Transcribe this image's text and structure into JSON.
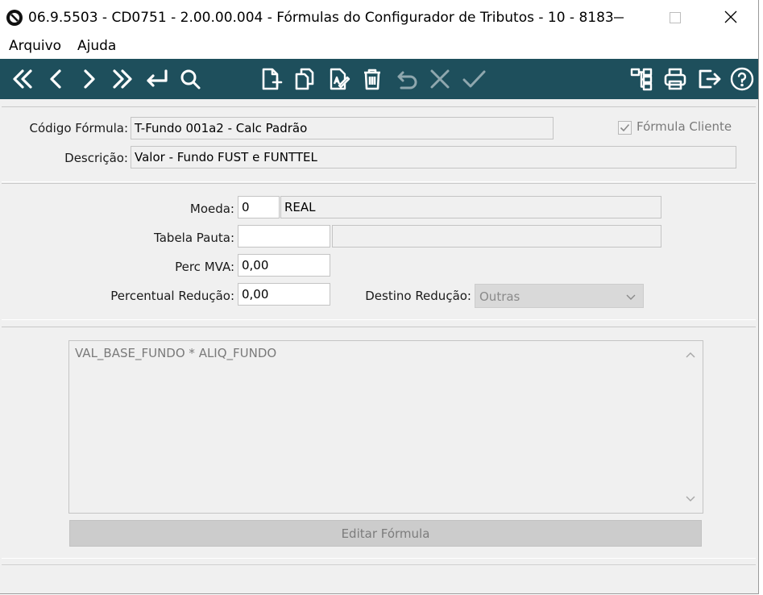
{
  "window": {
    "title": "06.9.5503 - CD0751 - 2.00.00.004 - Fórmulas do Configurador de Tributos - 10 - 8183"
  },
  "menu": {
    "items": [
      {
        "label": "Arquivo"
      },
      {
        "label": "Ajuda"
      }
    ]
  },
  "toolbar": {
    "colors": {
      "background": "#1e4f5c",
      "icon": "#ffffff"
    },
    "buttons": [
      {
        "icon": "first-record-icon",
        "enabled": true
      },
      {
        "icon": "previous-record-icon",
        "enabled": true
      },
      {
        "icon": "next-record-icon",
        "enabled": true
      },
      {
        "icon": "last-record-icon",
        "enabled": true
      },
      {
        "icon": "goto-record-icon",
        "enabled": true
      },
      {
        "icon": "search-icon",
        "enabled": true
      },
      {
        "icon": "new-record-icon",
        "enabled": true
      },
      {
        "icon": "copy-record-icon",
        "enabled": true
      },
      {
        "icon": "edit-record-icon",
        "enabled": true
      },
      {
        "icon": "delete-icon",
        "enabled": true
      },
      {
        "icon": "undo-icon",
        "enabled": false
      },
      {
        "icon": "cancel-icon",
        "enabled": false
      },
      {
        "icon": "confirm-icon",
        "enabled": false
      },
      {
        "icon": "tree-icon",
        "enabled": true
      },
      {
        "icon": "print-icon",
        "enabled": true
      },
      {
        "icon": "exit-icon",
        "enabled": true
      },
      {
        "icon": "help-icon",
        "enabled": true
      }
    ]
  },
  "header": {
    "codigo_label": "Código Fórmula:",
    "codigo_value": "T-Fundo 001a2 - Calc Padrão",
    "formula_cliente_label": "Fórmula Cliente",
    "formula_cliente_checked": true,
    "descricao_label": "Descrição:",
    "descricao_value": "Valor - Fundo FUST e FUNTTEL"
  },
  "params": {
    "moeda_label": "Moeda:",
    "moeda_code": "0",
    "moeda_name": "REAL",
    "tabela_pauta_label": "Tabela Pauta:",
    "tabela_pauta_code": "",
    "tabela_pauta_name": "",
    "perc_mva_label": "Perc MVA:",
    "perc_mva_value": "0,00",
    "perc_reducao_label": "Percentual Redução:",
    "perc_reducao_value": "0,00",
    "destino_reducao_label": "Destino Redução:",
    "destino_reducao_value": "Outras"
  },
  "formula": {
    "text": "VAL_BASE_FUNDO * ALIQ_FUNDO",
    "edit_button_label": "Editar Fórmula"
  }
}
